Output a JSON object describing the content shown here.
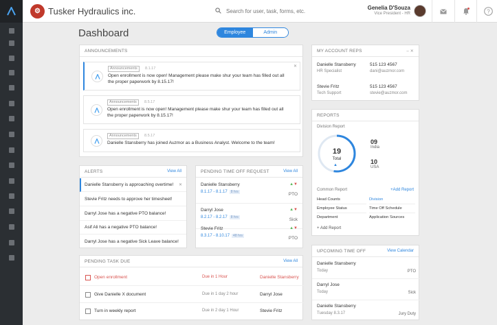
{
  "app": {
    "company": "Tusker Hydraulics inc.",
    "search_placeholder": "Search for user, task, forms, etc.",
    "user_name": "Genelia D'Souza",
    "user_title": "Vice President - HR"
  },
  "page": {
    "title": "Dashboard",
    "toggle": [
      "Employee",
      "Admin"
    ],
    "toggle_active": "Employee"
  },
  "announcements": {
    "title": "ANNOUNCEMENTS",
    "items": [
      {
        "tag": "Announcements",
        "date": "8.1.17",
        "text": "Open enrollment is now open! Management please make shur your team has filled out all the proper paperwork by 8.15.17!"
      },
      {
        "tag": "Announcements",
        "date": "8.5.17",
        "text": "Open enrollment is now open! Management please make shur your team has filled out all the proper paperwork by 8.15.17!"
      },
      {
        "tag": "Announcements",
        "date": "8.5.17",
        "text": "Danielle Stansberry has joined Auzmor as a Business Analyst. Welcome to the team!"
      }
    ]
  },
  "alerts": {
    "title": "ALERTS",
    "link": "View All",
    "items": [
      "Danielle Stansberry is approaching overtime!",
      "Stevie Fritz needs to approve her timesheet!",
      "Darryl Jose has a negative PTO balance!",
      "Asif Ali has a negative PTO balance!",
      "Darryl Jose has a negative Sick Leave balance!"
    ]
  },
  "pending_time_off": {
    "title": "PENDING TIME OFF REQUEST",
    "link": "View All",
    "items": [
      {
        "name": "Danielle Stansberry",
        "dates": "8.1.17 - 8.1.17",
        "hours": "8 hrs",
        "type": "PTO"
      },
      {
        "name": "Darryl Jose",
        "dates": "8.2.17 - 8.2.17",
        "hours": "8 hrs",
        "type": "Sick"
      },
      {
        "name": "Stevie Fritz",
        "dates": "8.3.17 - 8.10.17",
        "hours": "48 hrs",
        "type": "PTO"
      }
    ]
  },
  "pending_tasks": {
    "title": "PENDING TASK DUE",
    "link": "View All",
    "items": [
      {
        "name": "Open enrollment",
        "due": "Due in 1 Hour",
        "who": "Danielle Stansberry",
        "urgent": true
      },
      {
        "name": "Give Danielle X document",
        "due": "Due in 1 day 2 hour",
        "who": "Darryl Jose",
        "urgent": false
      },
      {
        "name": "Turn in weekly report",
        "due": "Due in 2 day 1 Hour",
        "who": "Stevie Fritz",
        "urgent": false
      }
    ]
  },
  "account_reps": {
    "title": "MY ACCOUNT REPS",
    "items": [
      {
        "name": "Danielle Stansberry",
        "role": "HR Specialist",
        "phone": "515 123 4567",
        "email": "dani@auzmor.com"
      },
      {
        "name": "Stevie Fritz",
        "role": "Tech Support",
        "phone": "515 123 4567",
        "email": "stevie@auzmor.com"
      }
    ]
  },
  "reports": {
    "title": "REPORTS",
    "division_title": "Division Report",
    "total_value": "19",
    "total_label": "Total",
    "india_value": "09",
    "india_label": "India",
    "usa_value": "10",
    "usa_label": "USA",
    "common_title": "Common Report",
    "add_link": "+Add Report",
    "grid": [
      [
        "Head Counts",
        "Division"
      ],
      [
        "Employee Status",
        "Time Off Schedule"
      ],
      [
        "Department",
        "Application Sources"
      ]
    ],
    "add_report": "+ Add Report"
  },
  "upcoming": {
    "title": "UPCOMING TIME OFF",
    "link": "View Calendar",
    "items": [
      {
        "name": "Danielle Stansberry",
        "date": "Today",
        "type": "PTO"
      },
      {
        "name": "Darryl Jose",
        "date": "Today",
        "type": "Sick"
      },
      {
        "name": "Danielle Stansberry",
        "date": "Tuesday 8.3.17",
        "type": "Jury Duty"
      }
    ]
  },
  "colors": {
    "accent": "#2e86de",
    "urgent": "#d9534f",
    "sidebar": "#2b2f33"
  }
}
